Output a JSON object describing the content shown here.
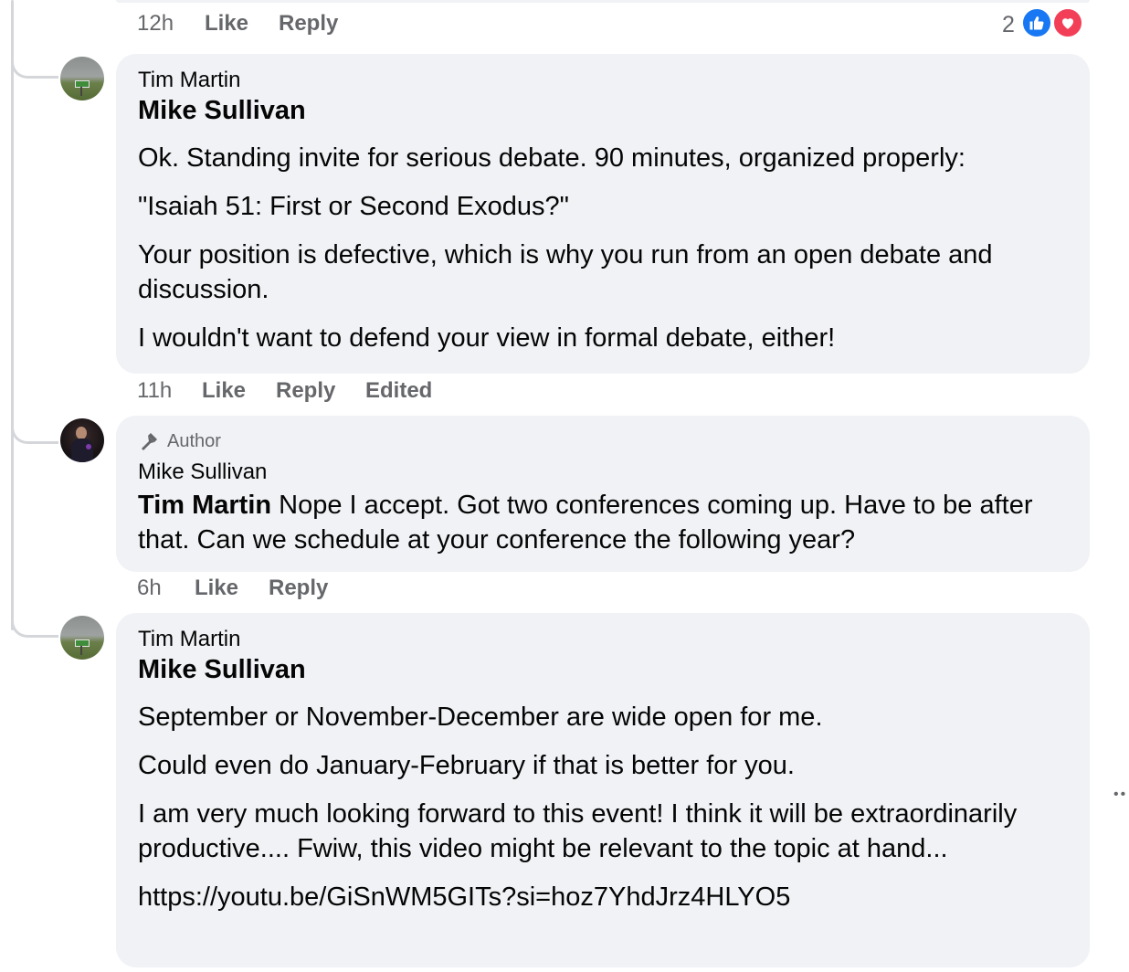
{
  "top_comment_meta": {
    "time": "12h",
    "like": "Like",
    "reply": "Reply",
    "reaction_count": "2",
    "reactions": [
      "like-icon",
      "love-icon"
    ]
  },
  "comments": [
    {
      "author_line": "Tim Martin",
      "mention": "Mike Sullivan",
      "paragraphs": [
        "Ok. Standing invite for serious debate. 90 minutes, organized properly:",
        "\"Isaiah 51: First or Second Exodus?\"",
        "Your position is defective, which is why you run from an open debate and discussion.",
        "I wouldn't want to defend your view in formal debate, either!"
      ],
      "meta": {
        "time": "11h",
        "like": "Like",
        "reply": "Reply",
        "edited": "Edited"
      }
    },
    {
      "badge": "Author",
      "author_line": "Mike Sullivan",
      "mention": "Tim Martin",
      "text": " Nope I accept. Got two conferences coming up. Have to be after that. Can we schedule at your conference the following year?",
      "meta": {
        "time": "6h",
        "like": "Like",
        "reply": "Reply"
      }
    },
    {
      "author_line": "Tim Martin",
      "mention": "Mike Sullivan",
      "paragraphs": [
        "September or November-December are wide open for me.",
        "Could even do January-February if that is better for you.",
        "I am very much looking forward to this event! I think it will be extraordinarily productive.... Fwiw, this video might be relevant to the topic at hand...",
        "https://youtu.be/GiSnWM5GITs?si=hoz7YhdJrz4HLYO5"
      ]
    }
  ],
  "colors": {
    "bubble": "#f0f2f5",
    "meta": "#65676b",
    "like_blue": "#1877f2",
    "love_red": "#f33e58"
  }
}
